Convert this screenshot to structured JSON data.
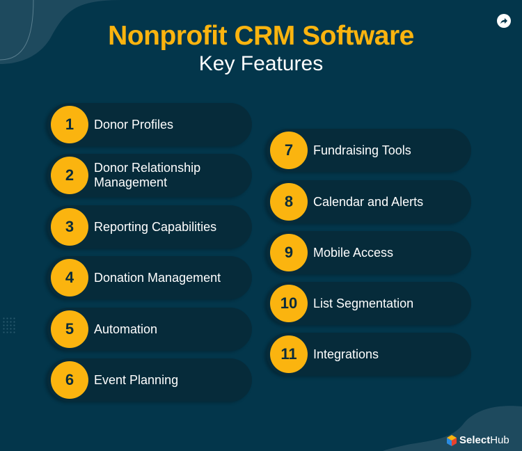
{
  "header": {
    "title": "Nonprofit CRM Software",
    "subtitle": "Key Features"
  },
  "colors": {
    "background": "#03364b",
    "pill": "#062b3a",
    "accent": "#fbb40f"
  },
  "share_icon": "share-arrow-icon",
  "features_left": [
    {
      "number": "1",
      "label": "Donor Profiles"
    },
    {
      "number": "2",
      "label": "Donor Relationship Management"
    },
    {
      "number": "3",
      "label": "Reporting Capabilities"
    },
    {
      "number": "4",
      "label": "Donation Management"
    },
    {
      "number": "5",
      "label": "Automation"
    },
    {
      "number": "6",
      "label": "Event Planning"
    }
  ],
  "features_right": [
    {
      "number": "7",
      "label": "Fundraising Tools"
    },
    {
      "number": "8",
      "label": "Calendar and Alerts"
    },
    {
      "number": "9",
      "label": "Mobile Access"
    },
    {
      "number": "10",
      "label": "List Segmentation"
    },
    {
      "number": "11",
      "label": "Integrations"
    }
  ],
  "brand": {
    "select": "Select",
    "hub": "Hub"
  }
}
